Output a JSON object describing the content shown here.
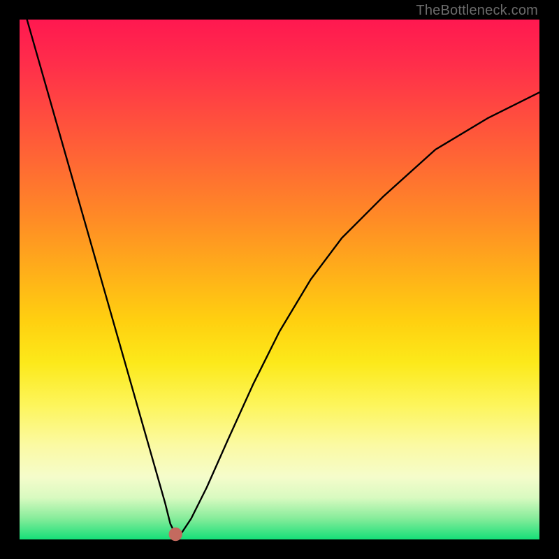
{
  "watermark": "TheBottleneck.com",
  "chart_data": {
    "type": "line",
    "title": "",
    "xlabel": "",
    "ylabel": "",
    "xlim": [
      0,
      100
    ],
    "ylim": [
      0,
      100
    ],
    "grid": false,
    "legend": false,
    "background_gradient_stops": [
      {
        "pct": 0,
        "color": "#ff1850"
      },
      {
        "pct": 9,
        "color": "#ff2f4a"
      },
      {
        "pct": 18,
        "color": "#ff4b3f"
      },
      {
        "pct": 28,
        "color": "#ff6a33"
      },
      {
        "pct": 38,
        "color": "#ff8a26"
      },
      {
        "pct": 48,
        "color": "#ffad1a"
      },
      {
        "pct": 58,
        "color": "#ffd010"
      },
      {
        "pct": 66,
        "color": "#fce91a"
      },
      {
        "pct": 74,
        "color": "#fdf55a"
      },
      {
        "pct": 82,
        "color": "#fbfaa4"
      },
      {
        "pct": 88,
        "color": "#f5fccb"
      },
      {
        "pct": 92,
        "color": "#d8fac0"
      },
      {
        "pct": 96,
        "color": "#85ec9a"
      },
      {
        "pct": 100,
        "color": "#15df78"
      }
    ],
    "x": [
      0,
      4,
      8,
      12,
      16,
      20,
      24,
      26,
      28,
      29,
      30,
      31,
      33,
      36,
      40,
      45,
      50,
      56,
      62,
      70,
      80,
      90,
      100
    ],
    "values": [
      105,
      91,
      77,
      63,
      49,
      35,
      21,
      14,
      7,
      3,
      1,
      1,
      4,
      10,
      19,
      30,
      40,
      50,
      58,
      66,
      75,
      81,
      86
    ],
    "marker": {
      "x": 30,
      "y": 1,
      "color": "#c46a5f"
    }
  }
}
